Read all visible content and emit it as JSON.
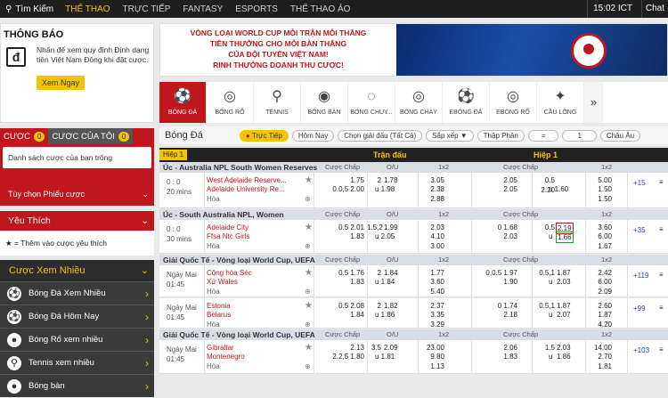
{
  "topbar": {
    "search": "Tìm Kiếm",
    "nav": [
      "THỂ THAO",
      "TRỰC TIẾP",
      "FANTASY",
      "ESPORTS",
      "THỂ THAO ẢO"
    ],
    "time": "15:02 ICT",
    "chat": "Chat"
  },
  "notice": {
    "title": "THÔNG BÁO",
    "icon_letter": "đ",
    "text": "Nhấn để xem quy định Định dạng tiền Việt Nam Đồng khi đặt cược.",
    "button": "Xem Ngay"
  },
  "bet": {
    "tab1": "CƯỢC",
    "tab1_count": "0",
    "tab2": "CƯỢC CỦA TÔI",
    "tab2_count": "0",
    "empty": "Danh sách cược của bạn trống",
    "options": "Tùy chọn Phiếu cược"
  },
  "fav": {
    "title": "Yêu Thích",
    "body": "= Thêm vào cược yêu thích"
  },
  "popular": {
    "title": "Cược Xem Nhiều",
    "items": [
      "Bóng Đá Xem Nhiều",
      "Bóng Đá Hôm Nay",
      "Bóng Rổ xem nhiều",
      "Tennis xem nhiều",
      "Bóng bàn"
    ]
  },
  "banner": {
    "l1": "VÒNG LOẠI WORLD CUP MỖI TRẬN MỖI THẮNG",
    "l2": "TIỀN THƯỞNG CHO MỖI BÀN THẮNG",
    "l3": "CỦA ĐỘI TUYỂN VIỆT NAM!",
    "l4": "RINH THƯỞNG DOANH THU CƯỢC!"
  },
  "sports": [
    "BÓNG ĐÁ",
    "BÓNG RỔ",
    "TENNIS",
    "BÓNG BÀN",
    "BÓNG CHUY...",
    "BÓNG CHÀY",
    "EBÓNG ĐÁ",
    "EBÓNG RỔ",
    "CẦU LÔNG"
  ],
  "filter": {
    "title": "Bóng Đá",
    "live": "Trực Tiếp",
    "today": "Hôm Nay",
    "pick": "Chọn giải đấu (Tất Cả)",
    "sort": "Sắp xếp",
    "decimal": "Thập Phân",
    "eq": "=",
    "one": "1",
    "region": "Châu Âu"
  },
  "thead": {
    "half": "Hiệp 1",
    "full": "Trận đấu",
    "first": "Hiệp 1"
  },
  "cols": {
    "hdp": "Cược Chấp",
    "ou": "O/U",
    "x12": "1x2"
  },
  "leagues": [
    "Úc - Australia NPL South Women Reserves",
    "Úc - South Australia NPL, Women",
    "Giải Quốc Tế - Vòng loại World Cup, UEFA",
    "Giải Quốc Tế - Vòng loại World Cup, UEFA"
  ],
  "draw": "Hòa",
  "matches": [
    {
      "t1": "0 : 0",
      "t2": "20 mins",
      "home": "West Adelaide Reserve...",
      "away": "Adelaide University Re...",
      "hl": "",
      "hh": "1.75",
      "ha": "0.0,5  2.00",
      "ol": "2",
      "oh": "1.78",
      "oa": "u  1.98",
      "x1": "3.05",
      "xx": "2.38",
      "x2": "2.88",
      "fh": "2.05",
      "fa": "2.05",
      "fol": "0.5  2.20",
      "foa": "u  1.60",
      "fx1": "5.00",
      "fxx": "1.50",
      "fx2": "1.50",
      "more": "+15"
    },
    {
      "t1": "0 : 0",
      "t2": "30 mins",
      "home": "Adelaide City",
      "away": "Ffsa Ntc Girls",
      "hh": "0.5  2.01",
      "ha": "1.83",
      "ol": "1.5,2",
      "oh": "1.99",
      "oa": "u  2.05",
      "x1": "2.03",
      "xx": "4.10",
      "x2": "3.00",
      "fh": "0  1.68",
      "fa": "2.03",
      "fol": "0.5",
      "fov": "2.19",
      "foa": "u",
      "foav": "1.66",
      "fx1": "3.60",
      "fxx": "6.00",
      "fx2": "1.67",
      "more": "+35"
    },
    {
      "t1": "Ngày Mai",
      "t2": "01:45",
      "home": "Cộng hòa Séc",
      "away": "Xứ Wales",
      "hh": "0.5  1.76",
      "ha": "1.83",
      "ol": "2",
      "oh": "1.84",
      "oa": "u  1.84",
      "x1": "1.77",
      "xx": "3.60",
      "x2": "5.40",
      "fh": "0,0.5  1.97",
      "fa": "1.90",
      "fol": "0.5,1",
      "foa": "u",
      "foov": "1.87",
      "foav": "2.03",
      "fx1": "2.42",
      "fxx": "6.00",
      "fx2": "2.09",
      "more": "+119"
    },
    {
      "t1": "Ngày Mai",
      "t2": "01:45",
      "home": "Estonia",
      "away": "Belarus",
      "hh": "0.5  2.08",
      "ha": "1.84",
      "ol": "2",
      "oh": "1.82",
      "oa": "u  1.86",
      "x1": "2.37",
      "xx": "3.35",
      "x2": "3.29",
      "fh": "0  1.74",
      "fa": "2.18",
      "fol": "0.5,1",
      "foa": "u",
      "foov": "1.87",
      "foav": "2.07",
      "fx1": "2.60",
      "fxx": "1.87",
      "fx2": "4.20",
      "more": "+99"
    },
    {
      "t1": "Ngày Mai",
      "t2": "01:45",
      "home": "Gibraltar",
      "away": "Montenegro",
      "hh": "2.13",
      "ha": "2.2,5  1.80",
      "ol": "3.5",
      "oh": "2.09",
      "oa": "u  1.81",
      "x1": "23.00",
      "xx": "9.80",
      "x2": "1.13",
      "fh": "2.06",
      "fa": "1.83",
      "fol": "1.5",
      "foa": "u",
      "foov": "2.03",
      "foav": "1.86",
      "fx1": "14.00",
      "fxx": "2.70",
      "fx2": "1.81",
      "more": "+103"
    }
  ]
}
